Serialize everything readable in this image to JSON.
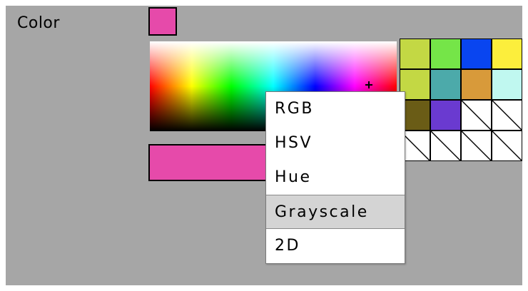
{
  "field": {
    "label": "Color",
    "current_color": "#e64aaa"
  },
  "palette": {
    "swatches": [
      "#c3d844",
      "#75e548",
      "#0945f0",
      "#fcee3c",
      "#c3d844",
      "#4caaaa",
      "#d89a3a",
      "#c0f8f0",
      "#6a5c16",
      "#6a3ad0",
      null,
      null,
      null,
      null,
      null,
      null
    ]
  },
  "mode_menu": {
    "items": [
      "RGB",
      "HSV",
      "Hue",
      "Grayscale",
      "2D"
    ],
    "highlighted": "Grayscale"
  }
}
